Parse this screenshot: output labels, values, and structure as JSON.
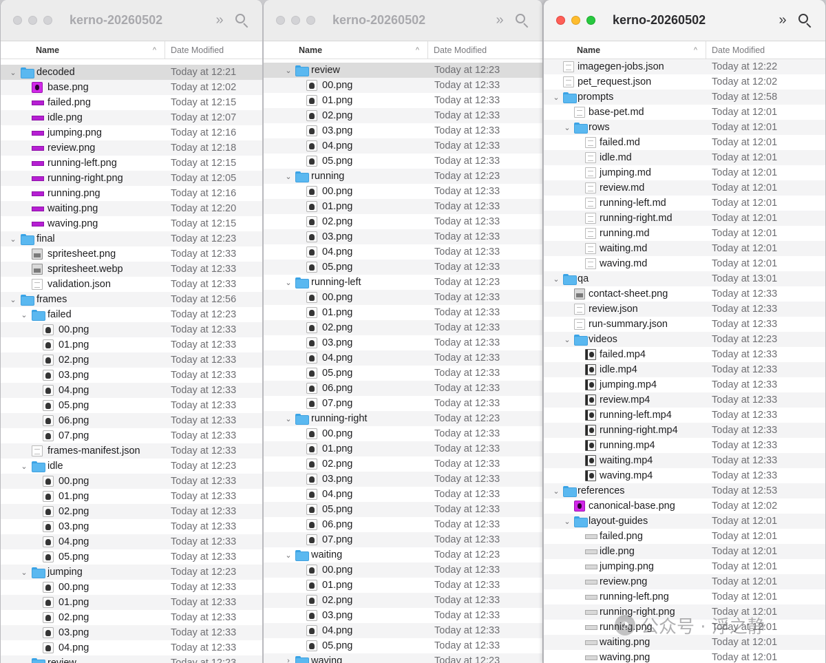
{
  "windows": [
    {
      "title": "kerno-20260502",
      "col_name": "Name",
      "col_date": "Date Modified",
      "rows": [
        {
          "indent": 0,
          "disc": "open",
          "icon": "folder",
          "name": "decoded",
          "date": "Today at 12:21",
          "sel": true
        },
        {
          "indent": 1,
          "icon": "magenta",
          "name": "base.png",
          "date": "Today at 12:02"
        },
        {
          "indent": 1,
          "icon": "strip",
          "name": "failed.png",
          "date": "Today at 12:15"
        },
        {
          "indent": 1,
          "icon": "strip",
          "name": "idle.png",
          "date": "Today at 12:07"
        },
        {
          "indent": 1,
          "icon": "strip",
          "name": "jumping.png",
          "date": "Today at 12:16"
        },
        {
          "indent": 1,
          "icon": "strip",
          "name": "review.png",
          "date": "Today at 12:18"
        },
        {
          "indent": 1,
          "icon": "strip",
          "name": "running-left.png",
          "date": "Today at 12:15"
        },
        {
          "indent": 1,
          "icon": "strip",
          "name": "running-right.png",
          "date": "Today at 12:05"
        },
        {
          "indent": 1,
          "icon": "strip",
          "name": "running.png",
          "date": "Today at 12:16"
        },
        {
          "indent": 1,
          "icon": "strip",
          "name": "waiting.png",
          "date": "Today at 12:20"
        },
        {
          "indent": 1,
          "icon": "strip",
          "name": "waving.png",
          "date": "Today at 12:15"
        },
        {
          "indent": 0,
          "disc": "open",
          "icon": "folder",
          "name": "final",
          "date": "Today at 12:23"
        },
        {
          "indent": 1,
          "icon": "image",
          "name": "spritesheet.png",
          "date": "Today at 12:33"
        },
        {
          "indent": 1,
          "icon": "image",
          "name": "spritesheet.webp",
          "date": "Today at 12:33"
        },
        {
          "indent": 1,
          "icon": "doc",
          "name": "validation.json",
          "date": "Today at 12:33"
        },
        {
          "indent": 0,
          "disc": "open",
          "icon": "folder",
          "name": "frames",
          "date": "Today at 12:56"
        },
        {
          "indent": 1,
          "disc": "open",
          "icon": "folder",
          "name": "failed",
          "date": "Today at 12:23"
        },
        {
          "indent": 2,
          "icon": "sprite",
          "name": "00.png",
          "date": "Today at 12:33"
        },
        {
          "indent": 2,
          "icon": "sprite",
          "name": "01.png",
          "date": "Today at 12:33"
        },
        {
          "indent": 2,
          "icon": "sprite",
          "name": "02.png",
          "date": "Today at 12:33"
        },
        {
          "indent": 2,
          "icon": "sprite",
          "name": "03.png",
          "date": "Today at 12:33"
        },
        {
          "indent": 2,
          "icon": "sprite",
          "name": "04.png",
          "date": "Today at 12:33"
        },
        {
          "indent": 2,
          "icon": "sprite",
          "name": "05.png",
          "date": "Today at 12:33"
        },
        {
          "indent": 2,
          "icon": "sprite",
          "name": "06.png",
          "date": "Today at 12:33"
        },
        {
          "indent": 2,
          "icon": "sprite",
          "name": "07.png",
          "date": "Today at 12:33"
        },
        {
          "indent": 1,
          "icon": "doc",
          "name": "frames-manifest.json",
          "date": "Today at 12:33"
        },
        {
          "indent": 1,
          "disc": "open",
          "icon": "folder",
          "name": "idle",
          "date": "Today at 12:23"
        },
        {
          "indent": 2,
          "icon": "sprite",
          "name": "00.png",
          "date": "Today at 12:33"
        },
        {
          "indent": 2,
          "icon": "sprite",
          "name": "01.png",
          "date": "Today at 12:33"
        },
        {
          "indent": 2,
          "icon": "sprite",
          "name": "02.png",
          "date": "Today at 12:33"
        },
        {
          "indent": 2,
          "icon": "sprite",
          "name": "03.png",
          "date": "Today at 12:33"
        },
        {
          "indent": 2,
          "icon": "sprite",
          "name": "04.png",
          "date": "Today at 12:33"
        },
        {
          "indent": 2,
          "icon": "sprite",
          "name": "05.png",
          "date": "Today at 12:33"
        },
        {
          "indent": 1,
          "disc": "open",
          "icon": "folder",
          "name": "jumping",
          "date": "Today at 12:23"
        },
        {
          "indent": 2,
          "icon": "sprite",
          "name": "00.png",
          "date": "Today at 12:33"
        },
        {
          "indent": 2,
          "icon": "sprite",
          "name": "01.png",
          "date": "Today at 12:33"
        },
        {
          "indent": 2,
          "icon": "sprite",
          "name": "02.png",
          "date": "Today at 12:33"
        },
        {
          "indent": 2,
          "icon": "sprite",
          "name": "03.png",
          "date": "Today at 12:33"
        },
        {
          "indent": 2,
          "icon": "sprite",
          "name": "04.png",
          "date": "Today at 12:33"
        },
        {
          "indent": 1,
          "disc": "open",
          "icon": "folder",
          "name": "review",
          "date": "Today at 12:23"
        }
      ]
    },
    {
      "title": "kerno-20260502",
      "col_name": "Name",
      "col_date": "Date Modified",
      "rows": [
        {
          "indent": 0,
          "disc": "open",
          "icon": "folder",
          "name": "review",
          "date": "Today at 12:23",
          "sel": true
        },
        {
          "indent": 1,
          "icon": "sprite",
          "name": "00.png",
          "date": "Today at 12:33"
        },
        {
          "indent": 1,
          "icon": "sprite",
          "name": "01.png",
          "date": "Today at 12:33"
        },
        {
          "indent": 1,
          "icon": "sprite",
          "name": "02.png",
          "date": "Today at 12:33"
        },
        {
          "indent": 1,
          "icon": "sprite",
          "name": "03.png",
          "date": "Today at 12:33"
        },
        {
          "indent": 1,
          "icon": "sprite",
          "name": "04.png",
          "date": "Today at 12:33"
        },
        {
          "indent": 1,
          "icon": "sprite",
          "name": "05.png",
          "date": "Today at 12:33"
        },
        {
          "indent": 0,
          "disc": "open",
          "icon": "folder",
          "name": "running",
          "date": "Today at 12:23"
        },
        {
          "indent": 1,
          "icon": "sprite",
          "name": "00.png",
          "date": "Today at 12:33"
        },
        {
          "indent": 1,
          "icon": "sprite",
          "name": "01.png",
          "date": "Today at 12:33"
        },
        {
          "indent": 1,
          "icon": "sprite",
          "name": "02.png",
          "date": "Today at 12:33"
        },
        {
          "indent": 1,
          "icon": "sprite",
          "name": "03.png",
          "date": "Today at 12:33"
        },
        {
          "indent": 1,
          "icon": "sprite",
          "name": "04.png",
          "date": "Today at 12:33"
        },
        {
          "indent": 1,
          "icon": "sprite",
          "name": "05.png",
          "date": "Today at 12:33"
        },
        {
          "indent": 0,
          "disc": "open",
          "icon": "folder",
          "name": "running-left",
          "date": "Today at 12:23"
        },
        {
          "indent": 1,
          "icon": "sprite",
          "name": "00.png",
          "date": "Today at 12:33"
        },
        {
          "indent": 1,
          "icon": "sprite",
          "name": "01.png",
          "date": "Today at 12:33"
        },
        {
          "indent": 1,
          "icon": "sprite",
          "name": "02.png",
          "date": "Today at 12:33"
        },
        {
          "indent": 1,
          "icon": "sprite",
          "name": "03.png",
          "date": "Today at 12:33"
        },
        {
          "indent": 1,
          "icon": "sprite",
          "name": "04.png",
          "date": "Today at 12:33"
        },
        {
          "indent": 1,
          "icon": "sprite",
          "name": "05.png",
          "date": "Today at 12:33"
        },
        {
          "indent": 1,
          "icon": "sprite",
          "name": "06.png",
          "date": "Today at 12:33"
        },
        {
          "indent": 1,
          "icon": "sprite",
          "name": "07.png",
          "date": "Today at 12:33"
        },
        {
          "indent": 0,
          "disc": "open",
          "icon": "folder",
          "name": "running-right",
          "date": "Today at 12:23"
        },
        {
          "indent": 1,
          "icon": "sprite",
          "name": "00.png",
          "date": "Today at 12:33"
        },
        {
          "indent": 1,
          "icon": "sprite",
          "name": "01.png",
          "date": "Today at 12:33"
        },
        {
          "indent": 1,
          "icon": "sprite",
          "name": "02.png",
          "date": "Today at 12:33"
        },
        {
          "indent": 1,
          "icon": "sprite",
          "name": "03.png",
          "date": "Today at 12:33"
        },
        {
          "indent": 1,
          "icon": "sprite",
          "name": "04.png",
          "date": "Today at 12:33"
        },
        {
          "indent": 1,
          "icon": "sprite",
          "name": "05.png",
          "date": "Today at 12:33"
        },
        {
          "indent": 1,
          "icon": "sprite",
          "name": "06.png",
          "date": "Today at 12:33"
        },
        {
          "indent": 1,
          "icon": "sprite",
          "name": "07.png",
          "date": "Today at 12:33"
        },
        {
          "indent": 0,
          "disc": "open",
          "icon": "folder",
          "name": "waiting",
          "date": "Today at 12:23"
        },
        {
          "indent": 1,
          "icon": "sprite",
          "name": "00.png",
          "date": "Today at 12:33"
        },
        {
          "indent": 1,
          "icon": "sprite",
          "name": "01.png",
          "date": "Today at 12:33"
        },
        {
          "indent": 1,
          "icon": "sprite",
          "name": "02.png",
          "date": "Today at 12:33"
        },
        {
          "indent": 1,
          "icon": "sprite",
          "name": "03.png",
          "date": "Today at 12:33"
        },
        {
          "indent": 1,
          "icon": "sprite",
          "name": "04.png",
          "date": "Today at 12:33"
        },
        {
          "indent": 1,
          "icon": "sprite",
          "name": "05.png",
          "date": "Today at 12:33"
        },
        {
          "indent": 0,
          "disc": "closed",
          "icon": "folder",
          "name": "waving",
          "date": "Today at 12:23"
        }
      ]
    },
    {
      "title": "kerno-20260502",
      "col_name": "Name",
      "col_date": "Date Modified",
      "rows": [
        {
          "indent": 0,
          "icon": "doc",
          "name": "imagegen-jobs.json",
          "date": "Today at 12:22"
        },
        {
          "indent": 0,
          "icon": "doc",
          "name": "pet_request.json",
          "date": "Today at 12:02"
        },
        {
          "indent": 0,
          "disc": "open",
          "icon": "folder",
          "name": "prompts",
          "date": "Today at 12:58"
        },
        {
          "indent": 1,
          "icon": "doc",
          "name": "base-pet.md",
          "date": "Today at 12:01"
        },
        {
          "indent": 1,
          "disc": "open",
          "icon": "folder",
          "name": "rows",
          "date": "Today at 12:01"
        },
        {
          "indent": 2,
          "icon": "doc",
          "name": "failed.md",
          "date": "Today at 12:01"
        },
        {
          "indent": 2,
          "icon": "doc",
          "name": "idle.md",
          "date": "Today at 12:01"
        },
        {
          "indent": 2,
          "icon": "doc",
          "name": "jumping.md",
          "date": "Today at 12:01"
        },
        {
          "indent": 2,
          "icon": "doc",
          "name": "review.md",
          "date": "Today at 12:01"
        },
        {
          "indent": 2,
          "icon": "doc",
          "name": "running-left.md",
          "date": "Today at 12:01"
        },
        {
          "indent": 2,
          "icon": "doc",
          "name": "running-right.md",
          "date": "Today at 12:01"
        },
        {
          "indent": 2,
          "icon": "doc",
          "name": "running.md",
          "date": "Today at 12:01"
        },
        {
          "indent": 2,
          "icon": "doc",
          "name": "waiting.md",
          "date": "Today at 12:01"
        },
        {
          "indent": 2,
          "icon": "doc",
          "name": "waving.md",
          "date": "Today at 12:01"
        },
        {
          "indent": 0,
          "disc": "open",
          "icon": "folder",
          "name": "qa",
          "date": "Today at 13:01"
        },
        {
          "indent": 1,
          "icon": "image",
          "name": "contact-sheet.png",
          "date": "Today at 12:33"
        },
        {
          "indent": 1,
          "icon": "doc",
          "name": "review.json",
          "date": "Today at 12:33"
        },
        {
          "indent": 1,
          "icon": "doc",
          "name": "run-summary.json",
          "date": "Today at 12:33"
        },
        {
          "indent": 1,
          "disc": "open",
          "icon": "folder",
          "name": "videos",
          "date": "Today at 12:23"
        },
        {
          "indent": 2,
          "icon": "video",
          "name": "failed.mp4",
          "date": "Today at 12:33"
        },
        {
          "indent": 2,
          "icon": "video",
          "name": "idle.mp4",
          "date": "Today at 12:33"
        },
        {
          "indent": 2,
          "icon": "video",
          "name": "jumping.mp4",
          "date": "Today at 12:33"
        },
        {
          "indent": 2,
          "icon": "video",
          "name": "review.mp4",
          "date": "Today at 12:33"
        },
        {
          "indent": 2,
          "icon": "video",
          "name": "running-left.mp4",
          "date": "Today at 12:33"
        },
        {
          "indent": 2,
          "icon": "video",
          "name": "running-right.mp4",
          "date": "Today at 12:33"
        },
        {
          "indent": 2,
          "icon": "video",
          "name": "running.mp4",
          "date": "Today at 12:33"
        },
        {
          "indent": 2,
          "icon": "video",
          "name": "waiting.mp4",
          "date": "Today at 12:33"
        },
        {
          "indent": 2,
          "icon": "video",
          "name": "waving.mp4",
          "date": "Today at 12:33"
        },
        {
          "indent": 0,
          "disc": "open",
          "icon": "folder",
          "name": "references",
          "date": "Today at 12:53"
        },
        {
          "indent": 1,
          "icon": "magenta",
          "name": "canonical-base.png",
          "date": "Today at 12:02"
        },
        {
          "indent": 1,
          "disc": "open",
          "icon": "folder",
          "name": "layout-guides",
          "date": "Today at 12:01"
        },
        {
          "indent": 2,
          "icon": "strip-grey",
          "name": "failed.png",
          "date": "Today at 12:01"
        },
        {
          "indent": 2,
          "icon": "strip-grey",
          "name": "idle.png",
          "date": "Today at 12:01"
        },
        {
          "indent": 2,
          "icon": "strip-grey",
          "name": "jumping.png",
          "date": "Today at 12:01"
        },
        {
          "indent": 2,
          "icon": "strip-grey",
          "name": "review.png",
          "date": "Today at 12:01"
        },
        {
          "indent": 2,
          "icon": "strip-grey",
          "name": "running-left.png",
          "date": "Today at 12:01"
        },
        {
          "indent": 2,
          "icon": "strip-grey",
          "name": "running-right.png",
          "date": "Today at 12:01"
        },
        {
          "indent": 2,
          "icon": "strip-grey",
          "name": "running.png",
          "date": "Today at 12:01"
        },
        {
          "indent": 2,
          "icon": "strip-grey",
          "name": "waiting.png",
          "date": "Today at 12:01"
        },
        {
          "indent": 2,
          "icon": "strip-grey",
          "name": "waving.png",
          "date": "Today at 12:01"
        }
      ]
    }
  ],
  "watermark": {
    "text": "公众号 · 浮之静"
  }
}
